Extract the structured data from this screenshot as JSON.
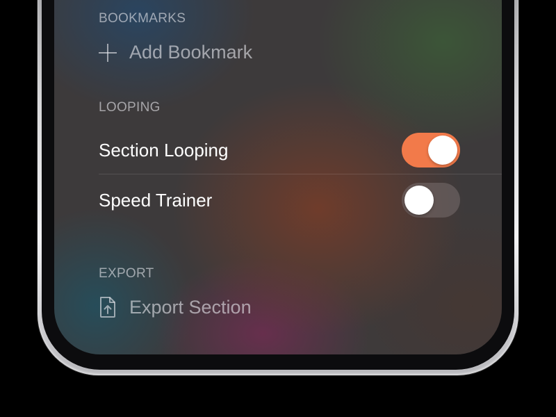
{
  "colors": {
    "toggle_on": "#F27A4A",
    "toggle_off": "rgba(120,110,110,0.55)",
    "secondary_text": "rgba(235,235,240,0.6)",
    "primary_text": "#FFFFFF"
  },
  "bookmarks": {
    "header": "BOOKMARKS",
    "add_label": "Add Bookmark",
    "add_icon": "plus-icon"
  },
  "looping": {
    "header": "LOOPING",
    "rows": [
      {
        "label": "Section Looping",
        "enabled": true
      },
      {
        "label": "Speed Trainer",
        "enabled": false
      }
    ]
  },
  "export": {
    "header": "EXPORT",
    "action_label": "Export Section",
    "action_icon": "document-upload-icon"
  }
}
